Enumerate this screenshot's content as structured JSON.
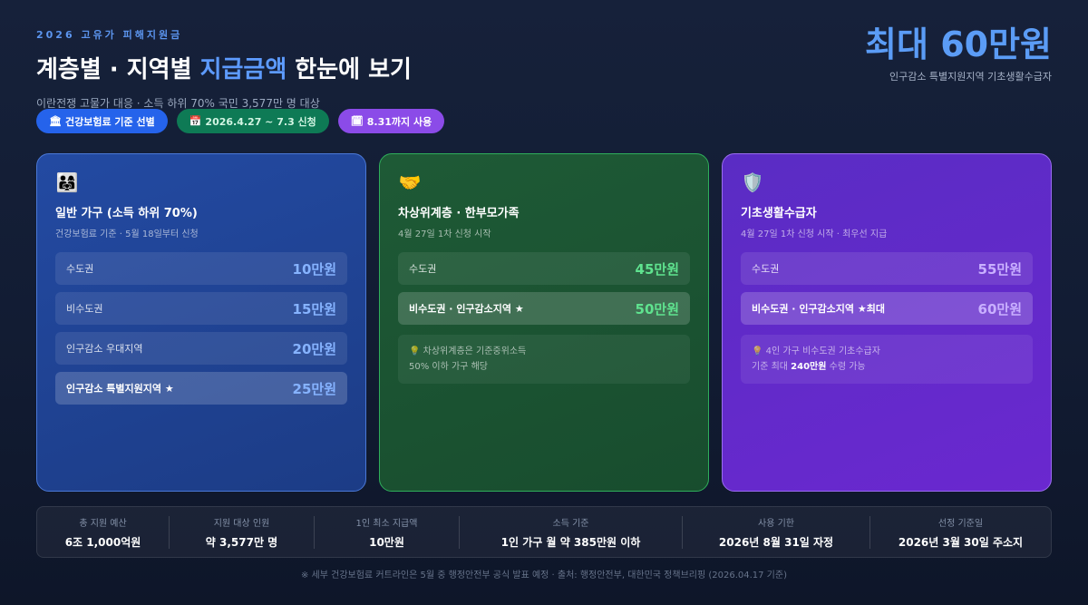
{
  "header": {
    "eyebrow": "2026 고유가 피해지원금",
    "title_part1": "계층별 · 지역별 ",
    "title_highlight": "지급금액",
    "title_part2": " 한눈에 보기",
    "subtitle": "이란전쟁 고물가 대응 · 소득 하위 70% 국민 3,577만 명 대상"
  },
  "pills": [
    {
      "icon": "bank-icon",
      "glyph": "🏛",
      "label": "건강보험료 기준 선별",
      "color": "#2563eb"
    },
    {
      "icon": "calendar-icon",
      "glyph": "📅",
      "label": "2026.4.27 ~ 7.3 신청",
      "color": "#0e7a55"
    },
    {
      "icon": "calendar-spiral-icon",
      "glyph": "🗓",
      "label": "8.31까지 사용",
      "color": "#8b4be8"
    }
  ],
  "max_box": {
    "amount": "최대 60만원",
    "caption": "인구감소 특별지원지역 기초생활수급자"
  },
  "cards": [
    {
      "icon": "family-icon",
      "glyph": "👨‍👩‍👧",
      "title": "일반 가구 (소득 하위 70%)",
      "subtitle": "건강보험료 기준 · 5월 18일부터 신청",
      "rows": [
        {
          "label": "수도권",
          "amount": "10만원"
        },
        {
          "label": "비수도권",
          "amount": "15만원"
        },
        {
          "label": "인구감소 우대지역",
          "amount": "20만원"
        },
        {
          "label": "인구감소 특별지원지역 ★",
          "amount": "25만원"
        }
      ]
    },
    {
      "icon": "handshake-icon",
      "glyph": "🤝",
      "title": "차상위계층 · 한부모가족",
      "subtitle": "4월 27일 1차 신청 시작",
      "rows": [
        {
          "label": "수도권",
          "amount": "45만원"
        },
        {
          "label": "비수도권 · 인구감소지역 ★",
          "amount": "50만원"
        }
      ],
      "note_line1": "차상위계층은 기준중위소득",
      "note_line2": "50% 이하 가구 해당"
    },
    {
      "icon": "shield-icon",
      "glyph": "🛡️",
      "title": "기초생활수급자",
      "subtitle": "4월 27일 1차 신청 시작 · 최우선 지급",
      "rows": [
        {
          "label": "수도권",
          "amount": "55만원"
        },
        {
          "label": "비수도권 · 인구감소지역 ★최대",
          "amount": "60만원"
        }
      ],
      "note_line1": "4인 가구 비수도권 기초수급자",
      "note_line2_pre": "기준 최대 ",
      "note_line2_bold": "240만원",
      "note_line2_post": " 수령 가능"
    }
  ],
  "stats": [
    {
      "label": "총 지원 예산",
      "value": "6조 1,000억원"
    },
    {
      "label": "지원 대상 인원",
      "value": "약 3,577만 명"
    },
    {
      "label": "1인 최소 지급액",
      "value": "10만원"
    },
    {
      "label": "소득 기준",
      "value": "1인 가구 월 약 385만원 이하"
    },
    {
      "label": "사용 기한",
      "value": "2026년 8월 31일 자정"
    },
    {
      "label": "선정 기준일",
      "value": "2026년 3월 30일 주소지"
    }
  ],
  "footer": "※ 세부 건강보험료 커트라인은 5월 중 행정안전부 공식 발표 예정 · 출처: 행정안전부, 대한민국 정책브리핑 (2026.04.17 기준)",
  "bulb_glyph": "💡"
}
